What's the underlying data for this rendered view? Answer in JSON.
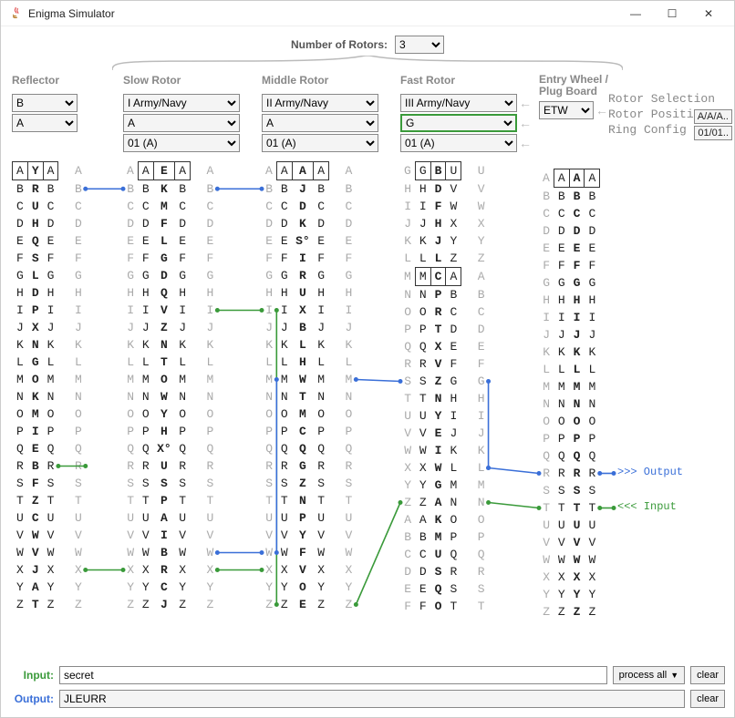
{
  "window": {
    "title": "Enigma Simulator"
  },
  "rotor_count": {
    "label": "Number of Rotors:",
    "value": "3"
  },
  "side_labels": [
    "Rotor Selection",
    "Rotor Position",
    "Ring Config"
  ],
  "side_badges": [
    "A/A/A..",
    "01/01.."
  ],
  "columns": {
    "reflector": {
      "header": "Reflector",
      "selectors": {
        "type": "B",
        "position": "A"
      },
      "alpha": [
        "A",
        "B",
        "C",
        "D",
        "E",
        "F",
        "G",
        "H",
        "I",
        "J",
        "K",
        "L",
        "M",
        "N",
        "O",
        "P",
        "Q",
        "R",
        "S",
        "T",
        "U",
        "V",
        "W",
        "X",
        "Y",
        "Z"
      ],
      "wiring": [
        "Y",
        "R",
        "U",
        "H",
        "Q",
        "S",
        "L",
        "D",
        "P",
        "X",
        "N",
        "G",
        "O",
        "K",
        "M",
        "I",
        "E",
        "B",
        "F",
        "Z",
        "C",
        "W",
        "V",
        "J",
        "A",
        "T"
      ]
    },
    "slow": {
      "header": "Slow Rotor",
      "selectors": {
        "type": "I",
        "type_tag": "Army/Navy",
        "position": "A",
        "ring": "01",
        "ring_tag": "(A)"
      },
      "alpha": [
        "A",
        "B",
        "C",
        "D",
        "E",
        "F",
        "G",
        "H",
        "I",
        "J",
        "K",
        "L",
        "M",
        "N",
        "O",
        "P",
        "Q",
        "R",
        "S",
        "T",
        "U",
        "V",
        "W",
        "X",
        "Y",
        "Z"
      ],
      "wiring_bold": [
        "E",
        "K",
        "M",
        "F",
        "L",
        "G",
        "D",
        "Q",
        "V",
        "Z",
        "N",
        "T",
        "O",
        "W",
        "Y",
        "H",
        "X",
        "U",
        "S",
        "P",
        "A",
        "I",
        "B",
        "R",
        "C",
        "J"
      ],
      "notch_index": 16
    },
    "middle": {
      "header": "Middle Rotor",
      "selectors": {
        "type": "II",
        "type_tag": "Army/Navy",
        "position": "A",
        "ring": "01",
        "ring_tag": "(A)"
      },
      "alpha": [
        "A",
        "B",
        "C",
        "D",
        "E",
        "F",
        "G",
        "H",
        "I",
        "J",
        "K",
        "L",
        "M",
        "N",
        "O",
        "P",
        "Q",
        "R",
        "S",
        "T",
        "U",
        "V",
        "W",
        "X",
        "Y",
        "Z"
      ],
      "wiring_bold": [
        "A",
        "J",
        "D",
        "K",
        "S",
        "I",
        "R",
        "U",
        "X",
        "B",
        "L",
        "H",
        "W",
        "T",
        "M",
        "C",
        "Q",
        "G",
        "Z",
        "N",
        "P",
        "Y",
        "F",
        "V",
        "O",
        "E"
      ],
      "notch_index": 4
    },
    "fast": {
      "header": "Fast Rotor",
      "selectors": {
        "type": "III",
        "type_tag": "Army/Navy",
        "position": "G",
        "ring": "01",
        "ring_tag": "(A)"
      },
      "left_col": [
        "G",
        "H",
        "I",
        "J",
        "K",
        "L",
        "M",
        "N",
        "O",
        "P",
        "Q",
        "R",
        "S",
        "T",
        "U",
        "V",
        "W",
        "X",
        "Y",
        "Z",
        "A",
        "B",
        "C",
        "D",
        "E",
        "F"
      ],
      "wiring_bold": [
        "B",
        "D",
        "F",
        "H",
        "J",
        "L",
        "C",
        "P",
        "R",
        "T",
        "X",
        "V",
        "Z",
        "N",
        "Y",
        "E",
        "I",
        "W",
        "G",
        "A",
        "K",
        "M",
        "U",
        "S",
        "Q",
        "O"
      ],
      "right_col": [
        "U",
        "V",
        "W",
        "X",
        "Y",
        "Z",
        "A",
        "B",
        "C",
        "D",
        "E",
        "F",
        "G",
        "H",
        "I",
        "J",
        "K",
        "L",
        "M",
        "N",
        "O",
        "P",
        "Q",
        "R",
        "S",
        "T"
      ],
      "notch_index": 6
    },
    "etw": {
      "header": "Entry Wheel / Plug Board",
      "header1": "Entry Wheel /",
      "header2": "Plug Board",
      "selectors": {
        "type": "ETW"
      },
      "alpha": [
        "A",
        "B",
        "C",
        "D",
        "E",
        "F",
        "G",
        "H",
        "I",
        "J",
        "K",
        "L",
        "M",
        "N",
        "O",
        "P",
        "Q",
        "R",
        "S",
        "T",
        "U",
        "V",
        "W",
        "X",
        "Y",
        "Z"
      ],
      "wiring_bold": [
        "A",
        "B",
        "C",
        "D",
        "E",
        "F",
        "G",
        "H",
        "I",
        "J",
        "K",
        "L",
        "M",
        "N",
        "O",
        "P",
        "Q",
        "R",
        "S",
        "T",
        "U",
        "V",
        "W",
        "X",
        "Y",
        "Z"
      ]
    }
  },
  "io_labels": {
    "output": ">>> Output",
    "input": "<<< Input"
  },
  "bottom": {
    "input_label": "Input:",
    "input_value": "secret",
    "output_label": "Output:",
    "output_value": "JLEURR",
    "process_btn": "process all",
    "clear_btn": "clear"
  },
  "colors": {
    "input_label": "#3a9a3a",
    "output_label": "#3a6fd8"
  }
}
